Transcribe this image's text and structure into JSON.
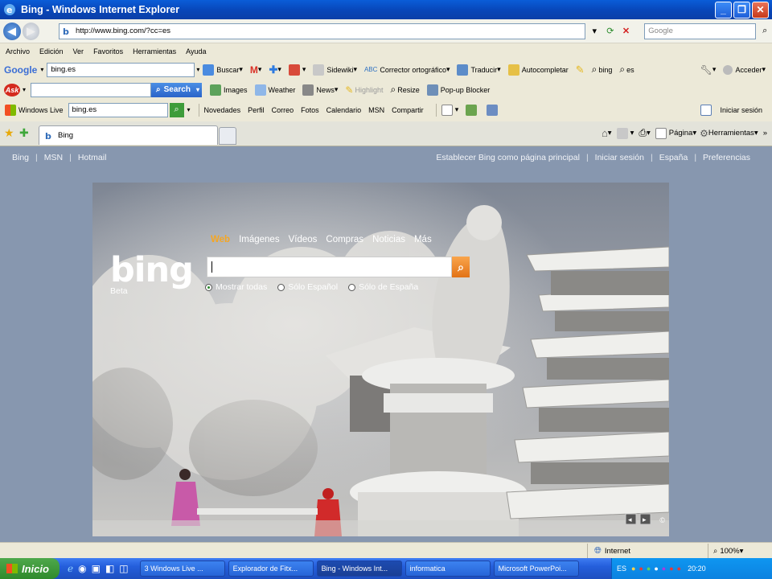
{
  "window": {
    "title": "Bing - Windows Internet Explorer"
  },
  "address": {
    "url": "http://www.bing.com/?cc=es",
    "search_placeholder": "Google"
  },
  "menu": [
    "Archivo",
    "Edición",
    "Ver",
    "Favoritos",
    "Herramientas",
    "Ayuda"
  ],
  "google_toolbar": {
    "brand": "Google",
    "query": "bing.es",
    "buscar": "Buscar",
    "sidewiki": "Sidewiki",
    "corrector": "Corrector ortográfico",
    "traducir": "Traducir",
    "autocompletar": "Autocompletar",
    "term1": "bing",
    "term2": "es",
    "acceder": "Acceder"
  },
  "ask_toolbar": {
    "brand": "Ask",
    "search": "Search",
    "images": "Images",
    "weather": "Weather",
    "news": "News",
    "highlight": "Highlight",
    "resize": "Resize",
    "popup": "Pop-up Blocker"
  },
  "live_toolbar": {
    "brand": "Windows Live",
    "query": "bing.es",
    "links": [
      "Novedades",
      "Perfil",
      "Correo",
      "Fotos",
      "Calendario",
      "MSN",
      "Compartir"
    ],
    "signin": "Iniciar sesión"
  },
  "tabs": {
    "active": "Bing"
  },
  "command_bar": {
    "pagina": "Página",
    "herramientas": "Herramientas"
  },
  "bing_page": {
    "nav_left": [
      "Bing",
      "MSN",
      "Hotmail"
    ],
    "nav_right": [
      "Establecer Bing como página principal",
      "Iniciar sesión",
      "España",
      "Preferencias"
    ],
    "logo": "bing",
    "beta": "Beta",
    "scopes": [
      "Web",
      "Imágenes",
      "Vídeos",
      "Compras",
      "Noticias",
      "Más"
    ],
    "search_value": "",
    "radio_options": [
      "Mostrar todas",
      "Sólo Español",
      "Sólo de España"
    ],
    "selected_radio": "Mostrar todas",
    "copyright": "©"
  },
  "status": {
    "zone": "Internet",
    "zoom": "100%"
  },
  "taskbar": {
    "start": "Inicio",
    "tasks": [
      "3 Windows Live ...",
      "Explorador de Fitx...",
      "Bing - Windows Int...",
      "informatica",
      "Microsoft PowerPoi..."
    ],
    "active_task": "Bing - Windows Int...",
    "lang": "ES",
    "clock": "20:20"
  }
}
